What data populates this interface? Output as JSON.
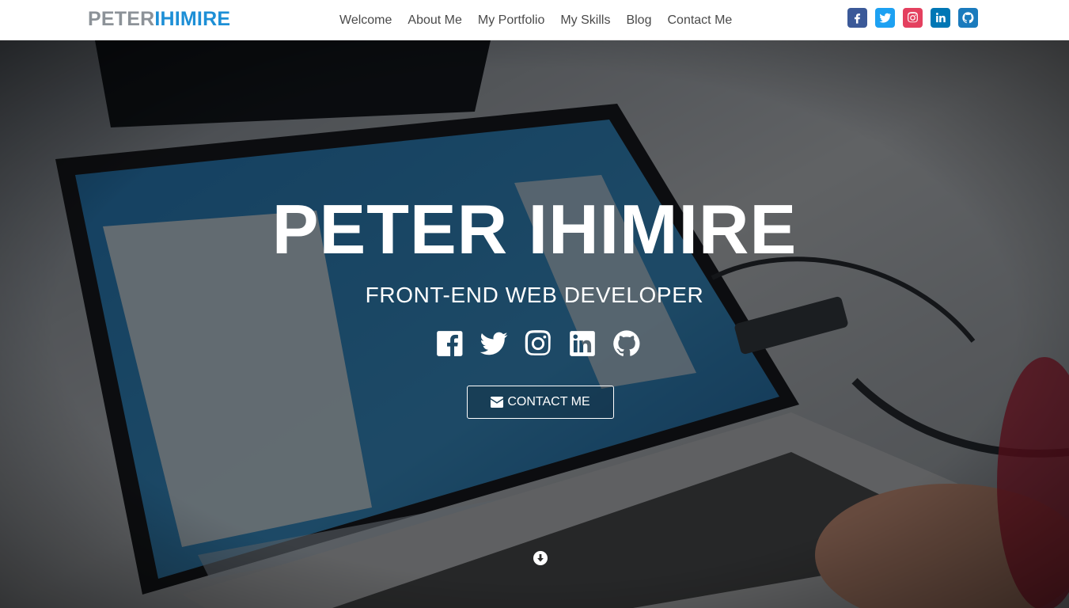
{
  "brand": {
    "part1": "PETER",
    "part2": "IHIMIRE"
  },
  "nav": {
    "links": [
      "Welcome",
      "About Me",
      "My Portfolio",
      "My Skills",
      "Blog",
      "Contact Me"
    ]
  },
  "header_social": [
    {
      "icon": "facebook-icon",
      "color": "#3b5998"
    },
    {
      "icon": "twitter-icon",
      "color": "#1da1f2"
    },
    {
      "icon": "instagram-icon",
      "color": "#e4405f"
    },
    {
      "icon": "linkedin-icon",
      "color": "#0077b5"
    },
    {
      "icon": "github-icon",
      "color": "#1b7bbd"
    }
  ],
  "hero": {
    "title": "PETER IHIMIRE",
    "subtitle": "FRONT-END WEB DEVELOPER",
    "social_icons": [
      "facebook-icon",
      "twitter-icon",
      "instagram-icon",
      "linkedin-icon",
      "github-icon"
    ],
    "contact_button": "CONTACT ME",
    "contact_icon": "envelope-icon",
    "scroll_icon": "arrow-down-circle-icon",
    "background": "laptop-photo"
  }
}
